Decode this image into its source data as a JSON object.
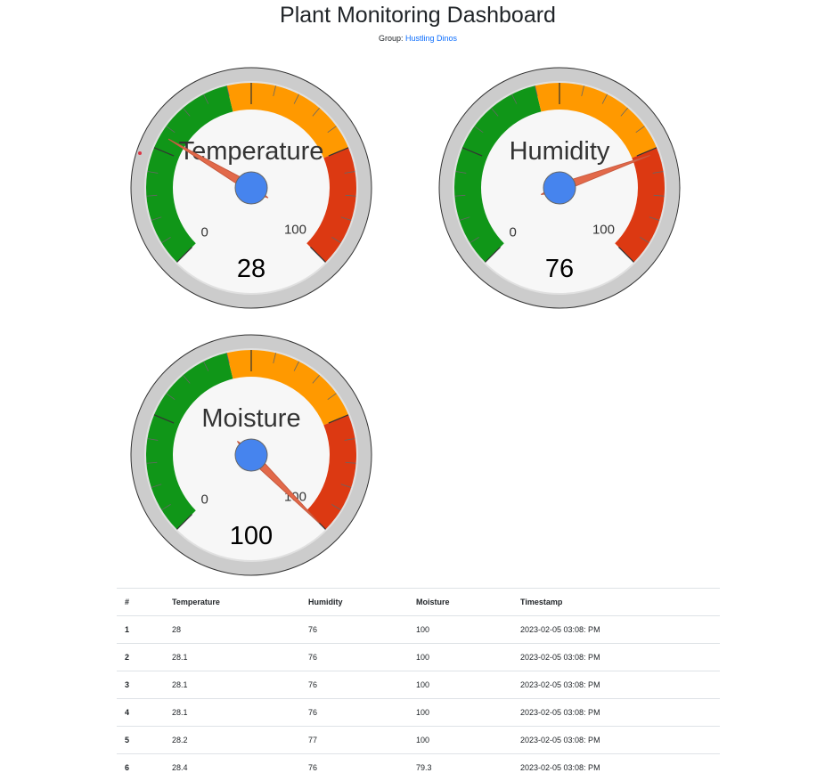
{
  "header": {
    "title": "Plant Monitoring Dashboard",
    "group_prefix": "Group:",
    "group_name": "Hustling Dinos"
  },
  "gauges": [
    {
      "label": "Temperature",
      "min": 0,
      "max": 100,
      "value": 28,
      "display_value": "28",
      "needle_value": 28
    },
    {
      "label": "Humidity",
      "min": 0,
      "max": 100,
      "value": 76,
      "display_value": "76",
      "needle_value": 76
    },
    {
      "label": "Moisture",
      "min": 0,
      "max": 100,
      "value": 100,
      "display_value": "100",
      "needle_value": 100
    }
  ],
  "gauge_zones": [
    {
      "from": 0,
      "to": 45,
      "color": "#109618"
    },
    {
      "from": 45,
      "to": 75,
      "color": "#FF9900"
    },
    {
      "from": 75,
      "to": 100,
      "color": "#DC3912"
    }
  ],
  "colors": {
    "needle": "#E2694A",
    "hub": "#4684EE",
    "face": "#F7F7F7",
    "bezel": "#CCCCCC",
    "link": "#0d6efd",
    "stray_dot": "#DC3545"
  },
  "table": {
    "headers": [
      "#",
      "Temperature",
      "Humidity",
      "Moisture",
      "Timestamp"
    ],
    "rows": [
      [
        "1",
        "28",
        "76",
        "100",
        "2023-02-05 03:08: PM"
      ],
      [
        "2",
        "28.1",
        "76",
        "100",
        "2023-02-05 03:08: PM"
      ],
      [
        "3",
        "28.1",
        "76",
        "100",
        "2023-02-05 03:08: PM"
      ],
      [
        "4",
        "28.1",
        "76",
        "100",
        "2023-02-05 03:08: PM"
      ],
      [
        "5",
        "28.2",
        "77",
        "100",
        "2023-02-05 03:08: PM"
      ],
      [
        "6",
        "28.4",
        "76",
        "79.3",
        "2023-02-05 03:08: PM"
      ]
    ]
  }
}
